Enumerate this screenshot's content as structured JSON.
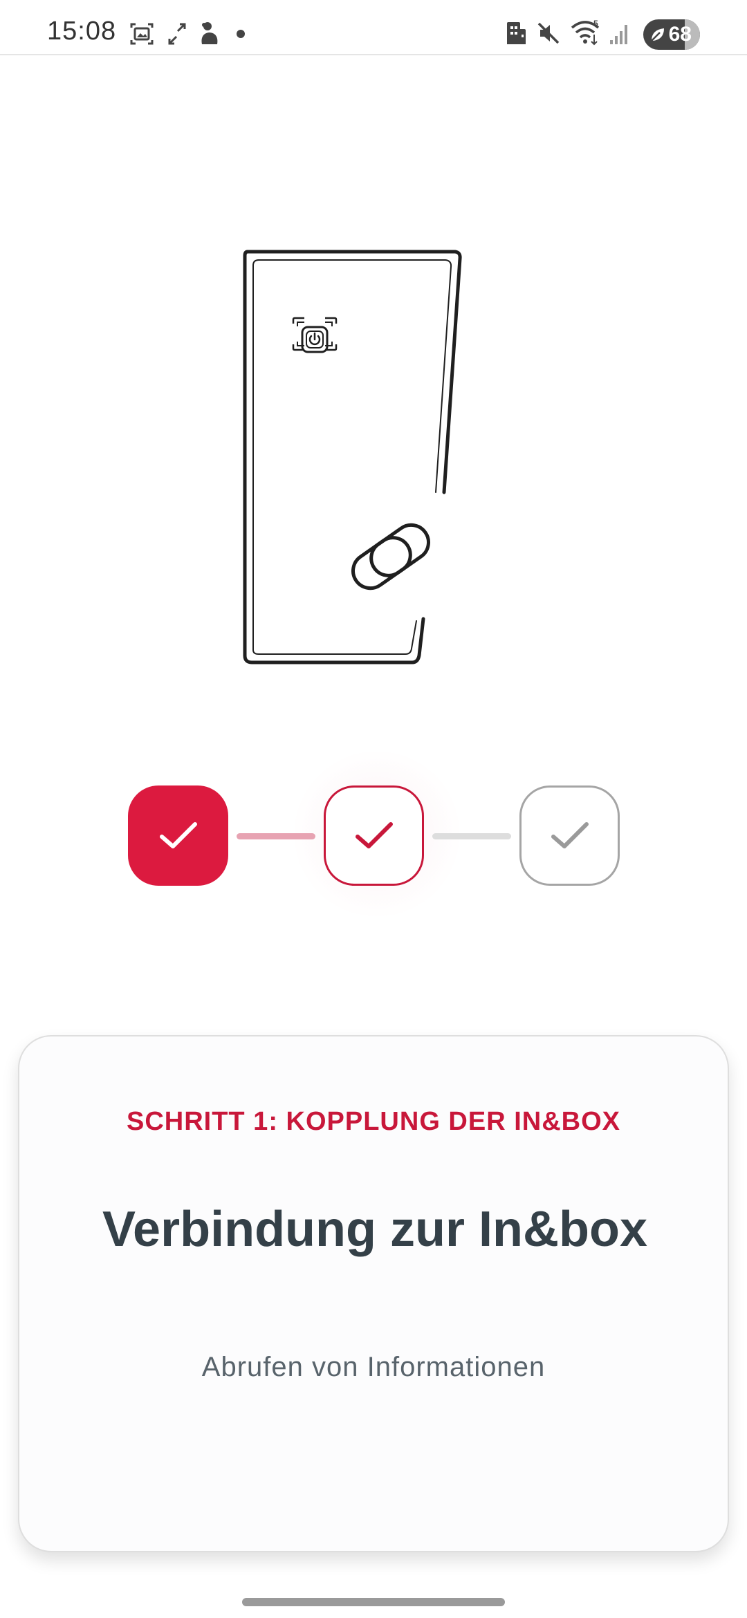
{
  "status_bar": {
    "time": "15:08",
    "battery_level": "68",
    "left_icons": [
      "screenshot-icon",
      "expand-icon",
      "dog-icon",
      "dot-icon"
    ],
    "right_icons": [
      "building-icon",
      "mute-icon",
      "wifi-icon",
      "signal-icon"
    ]
  },
  "illustration": {
    "icons": [
      "device-icon",
      "power-button-icon",
      "link-icon"
    ]
  },
  "steps": {
    "items": [
      {
        "state": "completed"
      },
      {
        "state": "active"
      },
      {
        "state": "pending"
      }
    ],
    "colors": {
      "accent": "#dc1a3f",
      "pending": "#a5a5a5"
    }
  },
  "card": {
    "step_label": "SCHRITT 1: KOPPLUNG DER IN&BOX",
    "title": "Verbindung zur In&box",
    "subtitle": "Abrufen von Informationen"
  }
}
